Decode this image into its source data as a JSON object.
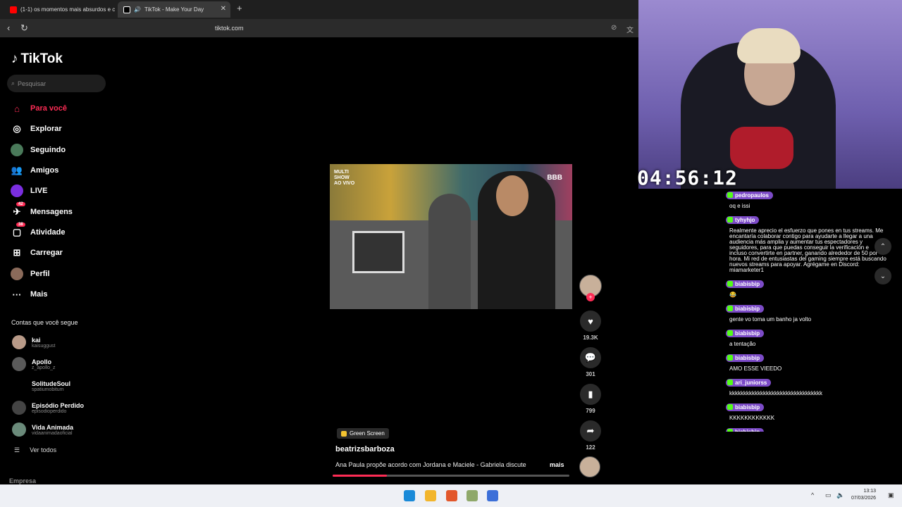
{
  "browser": {
    "tabs": [
      {
        "label": "(1-1) os momentos mais absurdos e c"
      },
      {
        "label": "TikTok - Make Your Day"
      }
    ],
    "url": "tiktok.com"
  },
  "sidebar": {
    "logo": "TikTok",
    "search_placeholder": "Pesquisar",
    "nav": [
      {
        "label": "Para você",
        "active": true
      },
      {
        "label": "Explorar"
      },
      {
        "label": "Seguindo"
      },
      {
        "label": "Amigos"
      },
      {
        "label": "LIVE"
      },
      {
        "label": "Mensagens",
        "badge": "42"
      },
      {
        "label": "Atividade",
        "badge": "38"
      },
      {
        "label": "Carregar"
      },
      {
        "label": "Perfil"
      },
      {
        "label": "Mais"
      }
    ],
    "following_title": "Contas que você segue",
    "following": [
      {
        "name": "kai",
        "user": "kaisuggust"
      },
      {
        "name": "Apollo",
        "user": "z_apollo_z"
      },
      {
        "name": "SolitudeSoul",
        "user": "spatiumobitum"
      },
      {
        "name": "Episódio Perdido",
        "user": "episodioperdido"
      },
      {
        "name": "Vida Animada",
        "user": "vidaanimadaoficial"
      }
    ],
    "see_all": "Ver todos",
    "footer": "Empresa"
  },
  "video": {
    "channel_logo": "MULTI SHOW AO VIVO",
    "show_logo": "BBB",
    "effect": "Green Screen",
    "author": "beatrizsbarboza",
    "description": "Ana Paula propõe acordo com Jordana e Maciele - Gabriela discute",
    "more": "mais",
    "progress": 0.23,
    "likes": "19.3K",
    "comments": "301",
    "saves": "799",
    "shares": "122"
  },
  "stream": {
    "timer": "04:56:12",
    "chat": [
      {
        "user": "pedropaulos",
        "text": "oq e issi"
      },
      {
        "user": "tyhyhjo",
        "text": "Realmente aprecio el esfuerzo que pones en tus streams. Me encantaría colaborar contigo para ayudarte a llegar a una audiencia más amplia y aumentar tus espectadores y seguidores, para que puedas conseguir la verificación e incluso convertirte en partner, ganando alrededor de 50 por hora. Mi red de entusiastas del gaming siempre está buscando nuevos streams para apoyar. Agrégame en Discord: miamarketer1"
      },
      {
        "user": "biabisbip",
        "text": "😂"
      },
      {
        "user": "biabisbip",
        "text": "gente vo toma um banho ja volto"
      },
      {
        "user": "biabisbip",
        "text": "a tentação"
      },
      {
        "user": "biabisbip",
        "text": "AMO ESSE VIEEDO"
      },
      {
        "user": "ari_juniorss",
        "text": "kkkkkkkkkkkkkkkkkkkkkkkkkkkkkkkkk"
      },
      {
        "user": "biabisbip",
        "text": "KKKKKKKKKKKK"
      },
      {
        "user": "biabisbip",
        "text": ""
      }
    ]
  },
  "taskbar": {
    "time": "13:13",
    "date": "07/03/2026"
  },
  "colors": {
    "accent": "#fe2c55",
    "chat_user_bg": "#7c4bc7",
    "kick_green": "#53fc18"
  }
}
